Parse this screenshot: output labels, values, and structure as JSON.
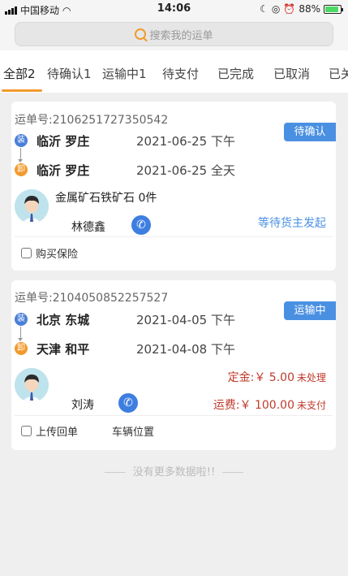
{
  "status_bar": {
    "carrier": "中国移动",
    "time": "14:06",
    "battery": "88%"
  },
  "search": {
    "placeholder": "搜索我的运单"
  },
  "tabs": [
    {
      "label": "全部2",
      "active": true
    },
    {
      "label": "待确认1"
    },
    {
      "label": "运输中1"
    },
    {
      "label": "待支付"
    },
    {
      "label": "已完成"
    },
    {
      "label": "已取消"
    },
    {
      "label": "已关"
    }
  ],
  "orders": [
    {
      "order_no": "运单号:2106251727350542",
      "status": "待确认",
      "load_badge": "装",
      "unload_badge": "卸",
      "from_city": "临沂 罗庄",
      "from_date": "2021-06-25 下午",
      "to_city": "临沂 罗庄",
      "to_date": "2021-06-25 全天",
      "goods": "金属矿石铁矿石  0件",
      "driver": "林德鑫",
      "note": "等待货主发起",
      "action": "购买保险"
    },
    {
      "order_no": "运单号:2104050852257527",
      "status": "运输中",
      "load_badge": "装",
      "unload_badge": "卸",
      "from_city": "北京 东城",
      "from_date": "2021-04-05 下午",
      "to_city": "天津 和平",
      "to_date": "2021-04-08 下午",
      "driver": "刘涛",
      "deposit": "定金:￥ 5.00",
      "deposit_status": "未处理",
      "freight": "运费:￥ 100.00",
      "freight_status": "未支付",
      "action_upload": "上传回单",
      "action_location": "车辆位置"
    }
  ],
  "footer": {
    "no_more": "没有更多数据啦!!"
  },
  "colors": {
    "accent": "#f29a2e",
    "blue": "#4a90e2",
    "red": "#c0392b"
  }
}
